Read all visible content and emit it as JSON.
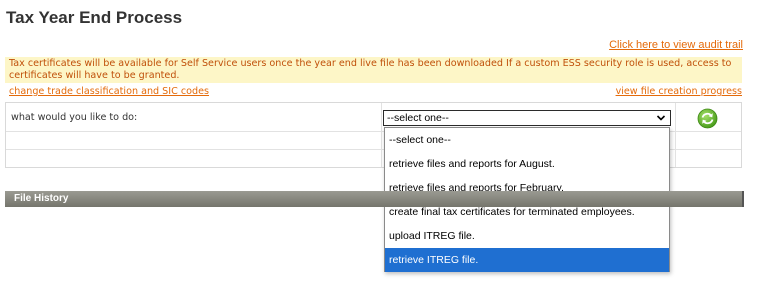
{
  "page": {
    "title": "Tax Year End Process"
  },
  "links": {
    "audit_trail": "Click here to view audit trail",
    "trade_classification": "change trade classification and SIC codes",
    "file_creation_progress": "view file creation progress"
  },
  "notice": {
    "text": "Tax certificates will be available for Self Service users once the year end live file has been downloaded If a custom ESS security role is used, access to certificates will have to be granted."
  },
  "form": {
    "question_label": "what would you like to do:",
    "select_value": "--select one--",
    "options": [
      {
        "label": "--select one--",
        "selected": false
      },
      {
        "label": "retrieve files and reports for August.",
        "selected": false
      },
      {
        "label": "retrieve files and reports for February.",
        "selected": false
      },
      {
        "label": "create final tax certificates for terminated employees.",
        "selected": false
      },
      {
        "label": "upload ITREG file.",
        "selected": false
      },
      {
        "label": "retrieve ITREG file.",
        "selected": true
      }
    ]
  },
  "file_history": {
    "header": "File History"
  },
  "icons": {
    "refresh": "refresh-icon",
    "chevron": "chevron-down-icon"
  },
  "colors": {
    "link": "#e46a0a",
    "notice_bg": "#fdf6c7",
    "highlight": "#1f6fd1",
    "header_bar": "#75756c",
    "refresh": "#6bbf2a"
  }
}
